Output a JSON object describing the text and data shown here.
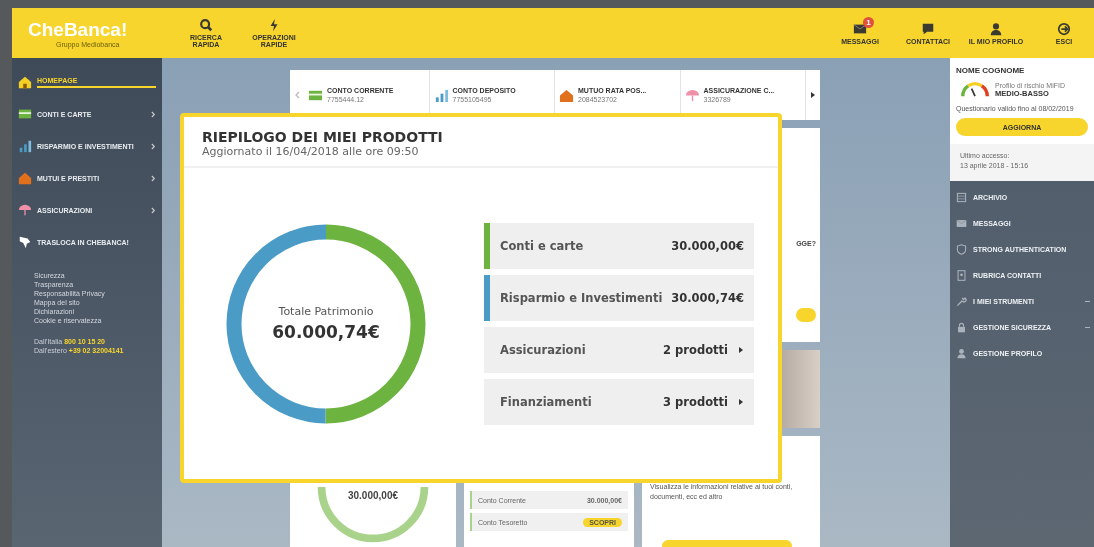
{
  "header": {
    "logo": "CheBanca!",
    "logo_tagline": "Gruppo Mediobanca",
    "left_actions": [
      {
        "kind": "search",
        "label": "RICERCA RAPIDA"
      },
      {
        "kind": "dollar",
        "label": "OPERAZIONI RAPIDE"
      }
    ],
    "right_actions": [
      {
        "kind": "mail",
        "label": "MESSAGGI",
        "badge": "1"
      },
      {
        "kind": "chat",
        "label": "CONTATTACI"
      },
      {
        "kind": "user",
        "label": "IL MIO PROFILO"
      },
      {
        "kind": "exit",
        "label": "ESCI"
      }
    ]
  },
  "sidebar": {
    "items": [
      {
        "kind": "home",
        "label": "HOMEPAGE",
        "selected": true,
        "expandable": false
      },
      {
        "kind": "card",
        "label": "CONTI E CARTE",
        "selected": false,
        "expandable": true
      },
      {
        "kind": "bars",
        "label": "RISPARMIO E INVESTIMENTI",
        "selected": false,
        "expandable": true
      },
      {
        "kind": "house",
        "label": "MUTUI E PRESTITI",
        "selected": false,
        "expandable": true
      },
      {
        "kind": "umbrella",
        "label": "ASSICURAZIONI",
        "selected": false,
        "expandable": true
      },
      {
        "kind": "flag",
        "label": "TRASLOCA IN CHEBANCA!",
        "selected": false,
        "expandable": false
      }
    ],
    "links": [
      "Sicurezza",
      "Trasparenza",
      "Responsabilità Privacy",
      "Mappa del sito",
      "Dichiarazioni",
      "Cookie e riservatezza"
    ],
    "phones": [
      {
        "label": "Dall'Italia",
        "number": "800 10 15 20"
      },
      {
        "label": "Dall'estero",
        "number": "+39 02 32004141"
      }
    ]
  },
  "product_strip": [
    {
      "kind": "card",
      "title": "CONTO CORRENTE",
      "number": "7755444.12"
    },
    {
      "kind": "bars",
      "title": "CONTO DEPOSITO",
      "number": "7755105495"
    },
    {
      "kind": "house",
      "title": "MUTUO RATA POS...",
      "number": "2084523702"
    },
    {
      "kind": "umbrella",
      "title": "ASSICURAZIONE C...",
      "number": "3326789"
    }
  ],
  "background_cards": {
    "donut_amount": "30.000,00€",
    "rows": [
      {
        "label": "Conto Corrente",
        "value": "30.000,00€"
      },
      {
        "label": "Conto Tesoretto",
        "value": "SCOPRI"
      }
    ],
    "question": "GGE?",
    "info_text": "Visualizza le informazioni relative ai tuoi conti, documenti, ecc ed altro"
  },
  "modal": {
    "title": "RIEPILOGO DEI MIEI PRODOTTI",
    "subtitle": "Aggiornato il 16/04/2018 alle ore 09:50",
    "total_label": "Totale Patrimonio",
    "total_value": "60.000,74€",
    "rows": [
      {
        "kind": "amount",
        "label": "Conti e carte",
        "value": "30.000,00€",
        "color": "#6db33f"
      },
      {
        "kind": "amount",
        "label": "Risparmio e Investimenti",
        "value": "30.000,74€",
        "color": "#4a9cc7"
      },
      {
        "kind": "link",
        "label": "Assicurazioni",
        "value": "2 prodotti"
      },
      {
        "kind": "link",
        "label": "Finanziamenti",
        "value": "3 prodotti"
      }
    ]
  },
  "profile": {
    "name": "NOME COGNOME",
    "risk_label": "Profilo di rischio MiFID",
    "risk_value": "MEDIO-BASSO",
    "validity": "Questionario valido fino al 08/02/2019",
    "button": "AGGIORNA",
    "last_access_label": "Ultimo accesso:",
    "last_access": "13 aprile 2018 - 15:16",
    "menu": [
      {
        "kind": "archive",
        "label": "ARCHIVIO",
        "expandable": false
      },
      {
        "kind": "mail",
        "label": "MESSAGGI",
        "expandable": false
      },
      {
        "kind": "shield",
        "label": "STRONG AUTHENTICATION",
        "expandable": false
      },
      {
        "kind": "book",
        "label": "RUBRICA CONTATTI",
        "expandable": false
      },
      {
        "kind": "wrench",
        "label": "I MIEI STRUMENTI",
        "expandable": true
      },
      {
        "kind": "lock",
        "label": "GESTIONE SICUREZZA",
        "expandable": true
      },
      {
        "kind": "user",
        "label": "GESTIONE PROFILO",
        "expandable": false
      }
    ]
  }
}
